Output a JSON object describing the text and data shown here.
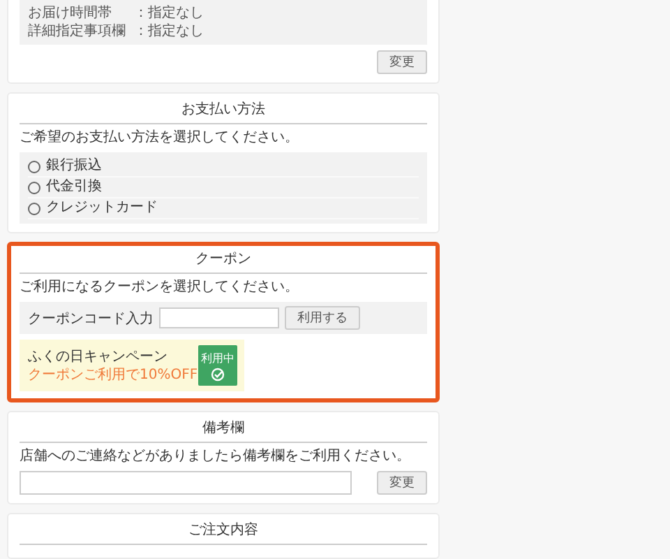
{
  "delivery": {
    "rows": [
      {
        "label": "お届け時間帯",
        "separator": "：",
        "value": "指定なし"
      },
      {
        "label": "詳細指定事項欄",
        "separator": "：",
        "value": "指定なし"
      }
    ],
    "button": "変更"
  },
  "payment": {
    "title": "お支払い方法",
    "instruction": "ご希望のお支払い方法を選択してください。",
    "options": [
      {
        "label": "銀行振込",
        "selected": false
      },
      {
        "label": "代金引換",
        "selected": false
      },
      {
        "label": "クレジットカード",
        "selected": false
      }
    ]
  },
  "coupon": {
    "title": "クーポン",
    "instruction": "ご利用になるクーポンを選択してください。",
    "code_label": "クーポンコード入力",
    "apply_button": "利用する",
    "highlighted": true,
    "coupons": [
      {
        "name": "ふくの日キャンペーン",
        "description": "クーポンご利用で10%OFF",
        "in_use": true,
        "badge": "利用中"
      }
    ]
  },
  "remarks": {
    "title": "備考欄",
    "instruction": "店舗へのご連絡などがありましたら備考欄をご利用ください。",
    "button": "変更"
  },
  "order": {
    "title": "ご注文内容"
  }
}
